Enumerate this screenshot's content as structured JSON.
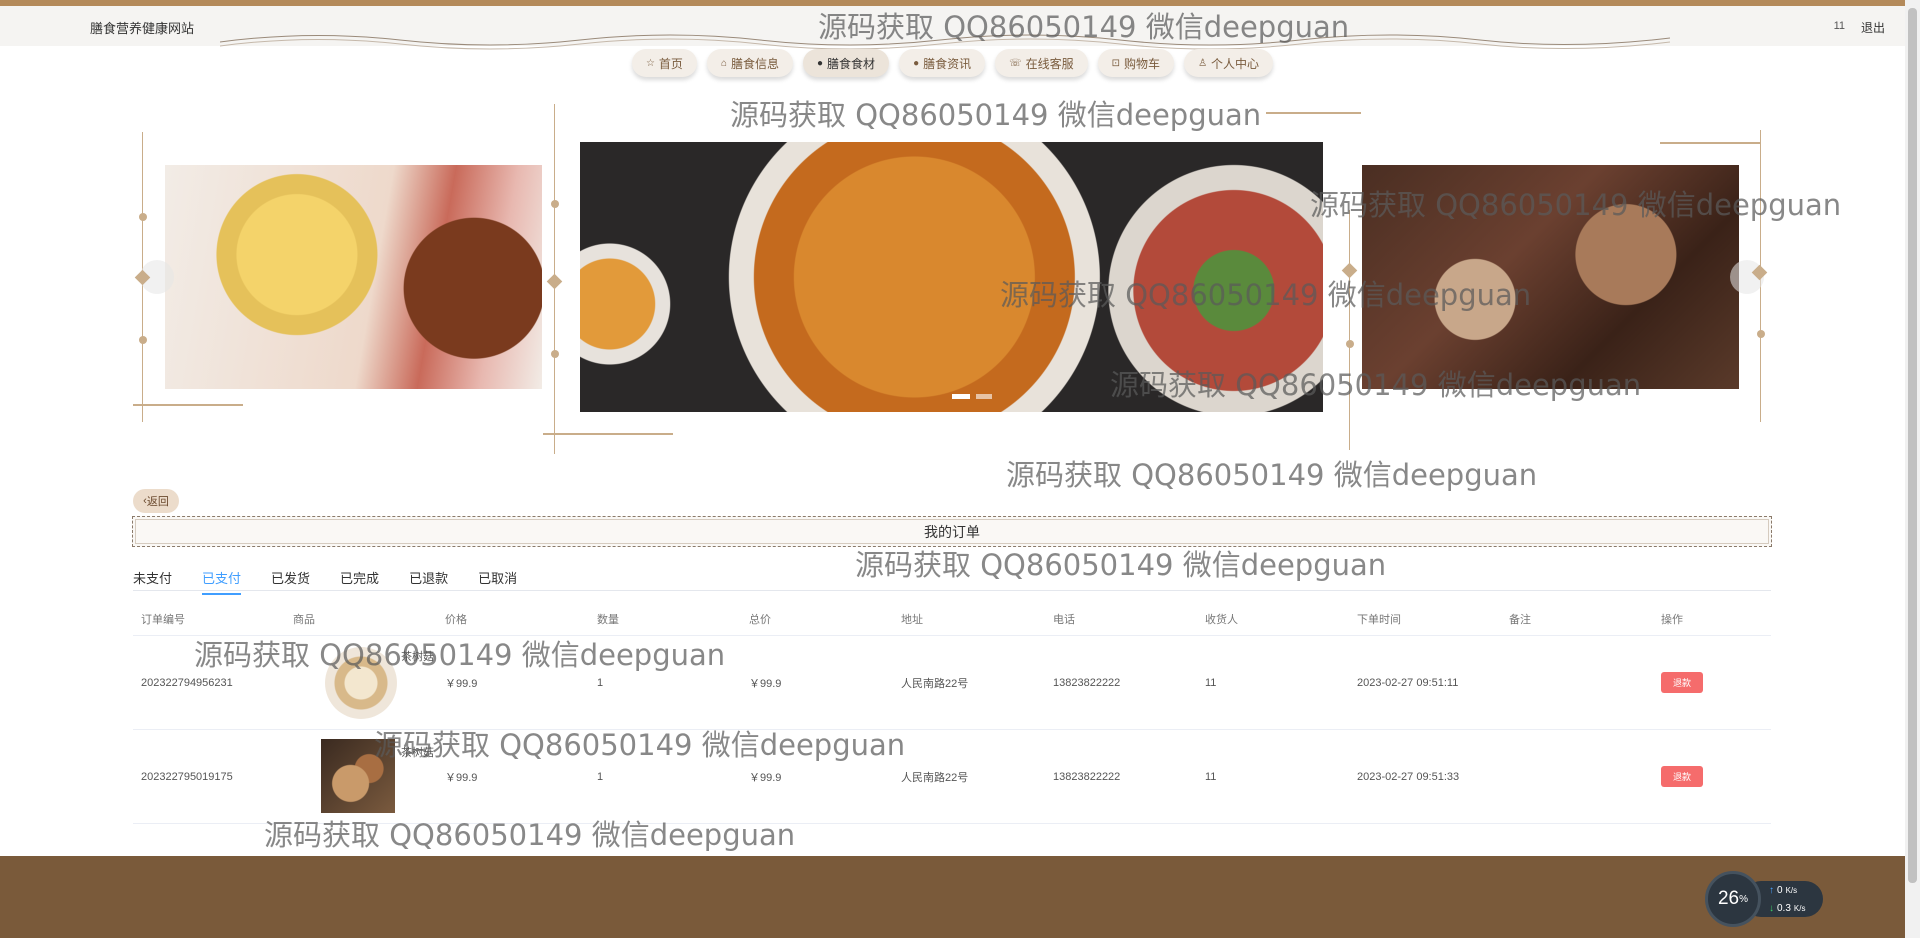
{
  "header": {
    "site_title": "膳食营养健康网站",
    "user_name": "11",
    "logout_label": "退出"
  },
  "nav": {
    "items": [
      {
        "label": "首页",
        "icon": "☆"
      },
      {
        "label": "膳食信息",
        "icon": "⌂"
      },
      {
        "label": "膳食食材",
        "icon": "●"
      },
      {
        "label": "膳食资讯",
        "icon": "●"
      },
      {
        "label": "在线客服",
        "icon": "☏"
      },
      {
        "label": "购物车",
        "icon": "⊡"
      },
      {
        "label": "个人中心",
        "icon": "♙"
      }
    ],
    "active_index": 2
  },
  "back_label": "返回",
  "orders_title": "我的订单",
  "tabs": [
    "未支付",
    "已支付",
    "已发货",
    "已完成",
    "已退款",
    "已取消"
  ],
  "active_tab": "已支付",
  "table": {
    "headers": [
      "订单编号",
      "商品",
      "价格",
      "数量",
      "总价",
      "地址",
      "电话",
      "收货人",
      "下单时间",
      "备注",
      "操作"
    ],
    "rows": [
      {
        "order_no": "202322794956231",
        "product": "茶树菇",
        "price": "￥99.9",
        "qty": "1",
        "total": "￥99.9",
        "address": "人民南路22号",
        "phone": "13823822222",
        "receiver": "11",
        "time": "2023-02-27 09:51:11",
        "note": "",
        "action": "退款"
      },
      {
        "order_no": "202322795019175",
        "product": "茶树菇",
        "price": "￥99.9",
        "qty": "1",
        "total": "￥99.9",
        "address": "人民南路22号",
        "phone": "13823822222",
        "receiver": "11",
        "time": "2023-02-27 09:51:33",
        "note": "",
        "action": "退款"
      }
    ]
  },
  "watermarks": [
    "源码获取 QQ86050149 微信deepguan",
    "源码获取 QQ86050149 微信deepguan",
    "源码获取 QQ86050149 微信deepguan",
    "源码获取 QQ86050149 微信deepguan",
    "源码获取 QQ86050149 微信deepguan",
    "源码获取 QQ86050149 微信deepguan",
    "源码获取 QQ86050149 微信deepguan",
    "源码获取 QQ86050149 微信deepguan",
    "源码获取 QQ86050149 微信deepguan",
    "源码获取 QQ86050149 微信deepguan",
    "源码获取 QQ86050149 微信deepguan"
  ],
  "net_widget": {
    "percent": "26",
    "percent_unit": "%",
    "upload": "0",
    "download": "0.3",
    "unit": "K/s"
  },
  "colors": {
    "brand_brown": "#7a5a3a",
    "accent_blue": "#409eff",
    "refund_red": "#f56c6c"
  }
}
